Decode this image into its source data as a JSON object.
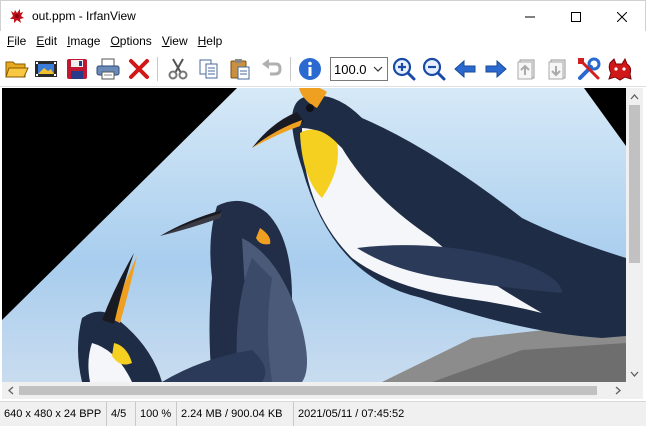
{
  "window": {
    "title": "out.ppm - IrfanView",
    "app_icon": "irfanview-red-cat-icon",
    "controls": [
      "minimize-icon",
      "maximize-icon",
      "close-icon"
    ]
  },
  "menu": {
    "items": [
      {
        "label": "File",
        "mnemonic": "F",
        "rest": "ile"
      },
      {
        "label": "Edit",
        "mnemonic": "E",
        "rest": "dit"
      },
      {
        "label": "Image",
        "mnemonic": "I",
        "rest": "mage"
      },
      {
        "label": "Options",
        "mnemonic": "O",
        "rest": "ptions"
      },
      {
        "label": "View",
        "mnemonic": "V",
        "rest": "iew"
      },
      {
        "label": "Help",
        "mnemonic": "H",
        "rest": "elp"
      }
    ]
  },
  "toolbar": {
    "buttons": [
      "open-folder-icon",
      "slideshow-icon",
      "save-icon",
      "print-icon",
      "delete-icon",
      "cut-icon",
      "copy-icon",
      "paste-icon",
      "undo-icon",
      "info-icon",
      "zoom-in-icon",
      "zoom-out-icon",
      "previous-icon",
      "next-icon",
      "first-page-icon",
      "last-page-icon",
      "properties-tools-icon",
      "irfanview-cat-icon"
    ],
    "zoom_value": "100.0"
  },
  "colors": {
    "sky": "#bfdcf2",
    "penguin_dark": "#2a3750",
    "beak_orange": "#f0a020",
    "belly_white": "#f4f6fa",
    "neck_yellow": "#f5d020"
  },
  "statusbar": {
    "dimensions": "640 x 480 x 24 BPP",
    "page": "4/5",
    "zoom": "100 %",
    "size": "2.24 MB / 900.04 KB",
    "datetime": "2021/05/11 / 07:45:52"
  }
}
